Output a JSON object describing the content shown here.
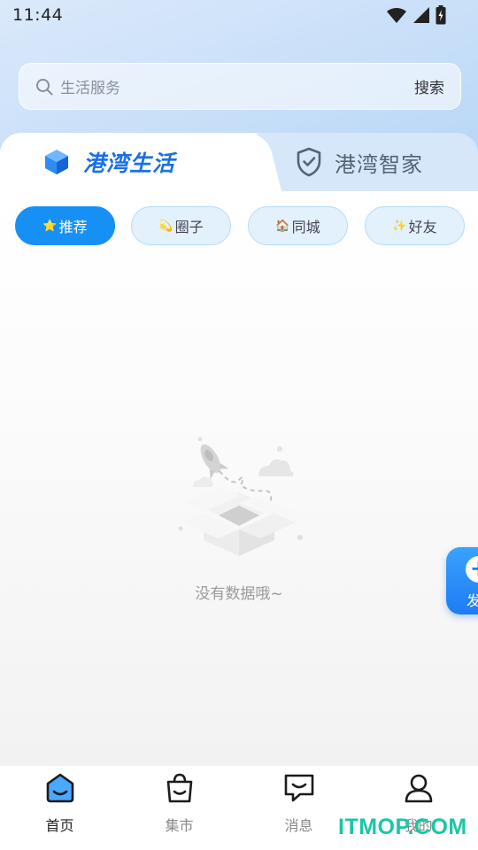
{
  "status_bar": {
    "time": "11:44"
  },
  "search": {
    "placeholder": "生活服务",
    "button": "搜索"
  },
  "tabs": [
    {
      "label": "港湾生活",
      "active": true,
      "icon": "cube-icon"
    },
    {
      "label": "港湾智家",
      "active": false,
      "icon": "shield-check-icon"
    }
  ],
  "chips": [
    {
      "emoji": "⭐",
      "label": "推荐",
      "active": true
    },
    {
      "emoji": "💫",
      "label": "圈子",
      "active": false
    },
    {
      "emoji": "🏠",
      "label": "同城",
      "active": false
    },
    {
      "emoji": "✨",
      "label": "好友",
      "active": false
    }
  ],
  "empty_state": {
    "text": "没有数据哦~",
    "icon": "empty-box-illustration"
  },
  "fab": {
    "symbol": "+",
    "label": "发"
  },
  "bottom_nav": [
    {
      "label": "首页",
      "icon": "home-smile-icon",
      "active": true
    },
    {
      "label": "集市",
      "icon": "shopping-bag-icon",
      "active": false
    },
    {
      "label": "消息",
      "icon": "message-icon",
      "active": false
    },
    {
      "label": "我的",
      "icon": "user-icon",
      "active": false
    }
  ],
  "watermark": "ITMOP.COM",
  "colors": {
    "accent": "#1790f5",
    "tab_active": "#1a6fe8",
    "watermark": "#1cc6a5"
  }
}
